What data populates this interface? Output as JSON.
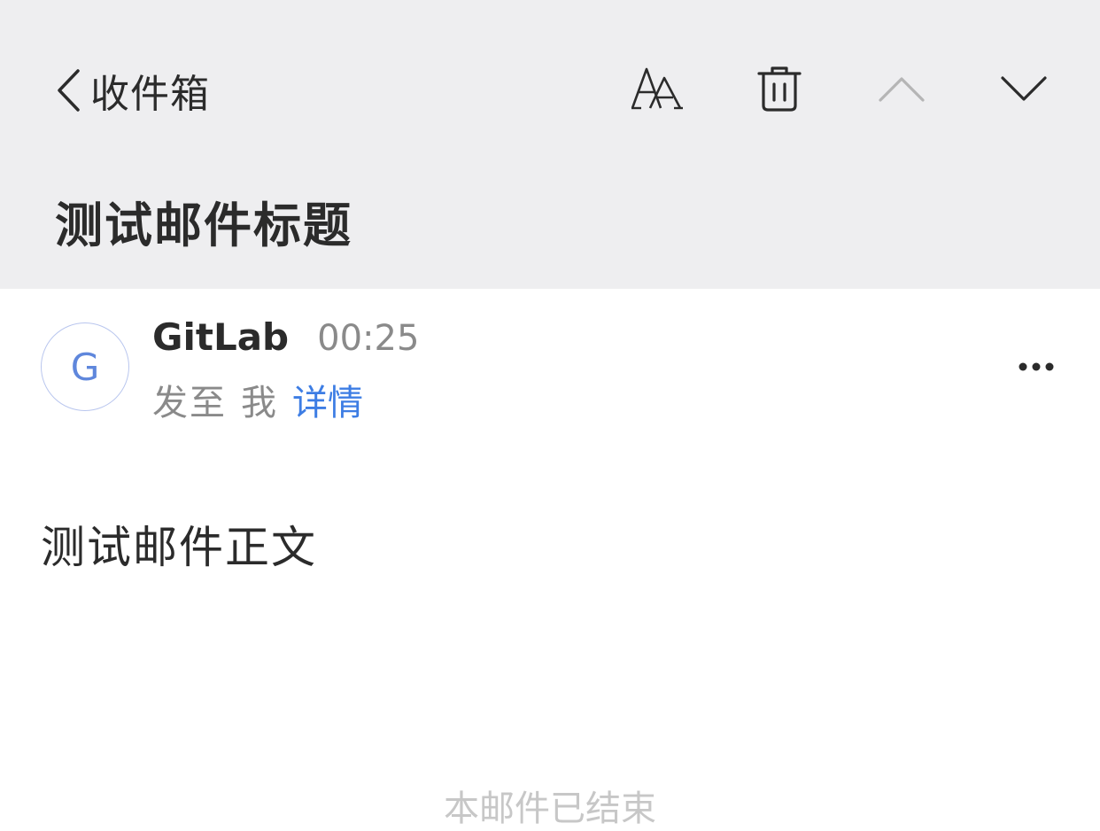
{
  "nav": {
    "back_label": "收件箱"
  },
  "toolbar": {
    "icons": [
      "text-size-icon",
      "trash-icon",
      "chevron-up-icon",
      "chevron-down-icon"
    ]
  },
  "email": {
    "subject": "测试邮件标题",
    "avatar_initial": "G",
    "sender_name": "GitLab",
    "time": "00:25",
    "to_prefix": "发至",
    "to_name": "我",
    "details_label": "详情",
    "body": "测试邮件正文",
    "footer_hint": "本邮件已结束"
  },
  "colors": {
    "header_bg": "#eeeef0",
    "link": "#3d7de4",
    "avatar_text": "#5f87dc",
    "muted_text": "#8a8a8a"
  }
}
